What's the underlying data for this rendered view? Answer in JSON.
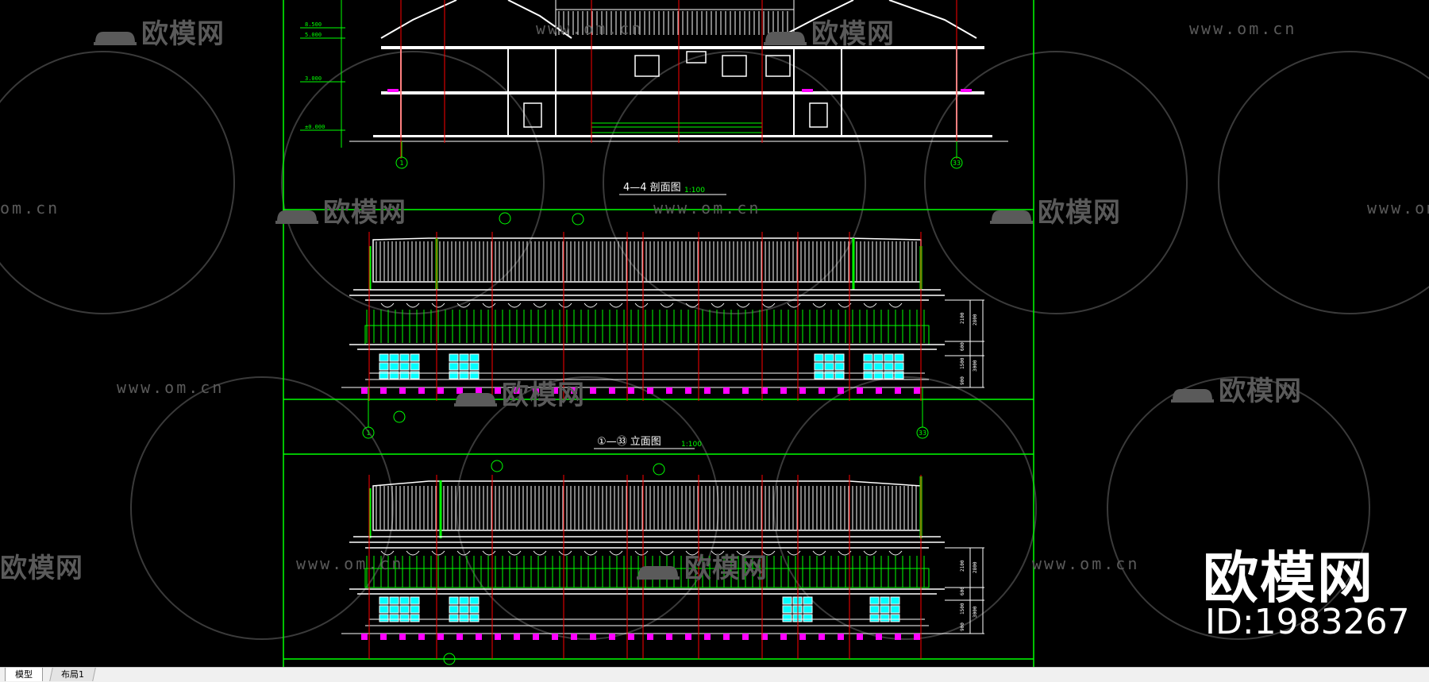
{
  "watermark": {
    "brand": "欧模网",
    "url": "www.om.cn",
    "url_cut": "om.cn",
    "brand_cut": "欧模网"
  },
  "brand_corner": {
    "name": "欧模网",
    "id": "ID:1983267"
  },
  "drawing": {
    "section": {
      "title": "4—4 剖面图",
      "scale": "1:100",
      "axis_left": "1",
      "axis_right": "33",
      "levels": [
        "8.500",
        "5.000",
        "3.000",
        "±0.000"
      ]
    },
    "elevation1": {
      "title": "①—㉝ 立面图",
      "scale": "1:100",
      "axis_left": "1",
      "axis_right": "33",
      "dims": [
        "2100",
        "2800",
        "600",
        "1500",
        "3000",
        "900"
      ]
    },
    "elevation2": {
      "dims": [
        "2100",
        "2800",
        "600",
        "1500",
        "3000",
        "900"
      ]
    }
  },
  "tabs": {
    "model": "模型",
    "layout1": "布局1"
  },
  "colors": {
    "background": "#000000",
    "frame_green": "#00ff00",
    "line_white": "#ffffff",
    "axis_red": "#ff0000",
    "window_cyan": "#00ffff",
    "base_magenta": "#ff00ff",
    "watermark_gray": "#5a5a5a"
  }
}
